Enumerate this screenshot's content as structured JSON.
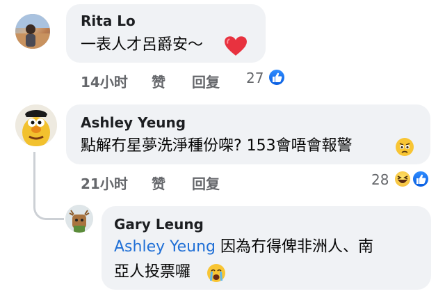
{
  "comments": [
    {
      "author": "Rita Lo",
      "text": "一表人才呂爵安～",
      "time": "14小时",
      "like": "赞",
      "reply": "回复",
      "reactions": "27"
    },
    {
      "author": "Ashley Yeung",
      "text": "點解冇星夢洗淨種份㗎? 153會唔會報警",
      "time": "21小时",
      "like": "赞",
      "reply": "回复",
      "reactions": "28"
    }
  ],
  "reply": {
    "author": "Gary Leung",
    "mention": "Ashley Yeung",
    "text_line1": "因為冇得俾非洲人、南",
    "text_line2": "亞人投票囉"
  },
  "colors": {
    "bubble": "#f0f2f5",
    "link": "#1f6fd6",
    "meta": "#65676b",
    "heart": "#e8323f",
    "like_blue": "#0a6cf0"
  },
  "icons": [
    "heart-icon",
    "like-icon",
    "haha-icon",
    "sad-icon",
    "crying-icon"
  ]
}
